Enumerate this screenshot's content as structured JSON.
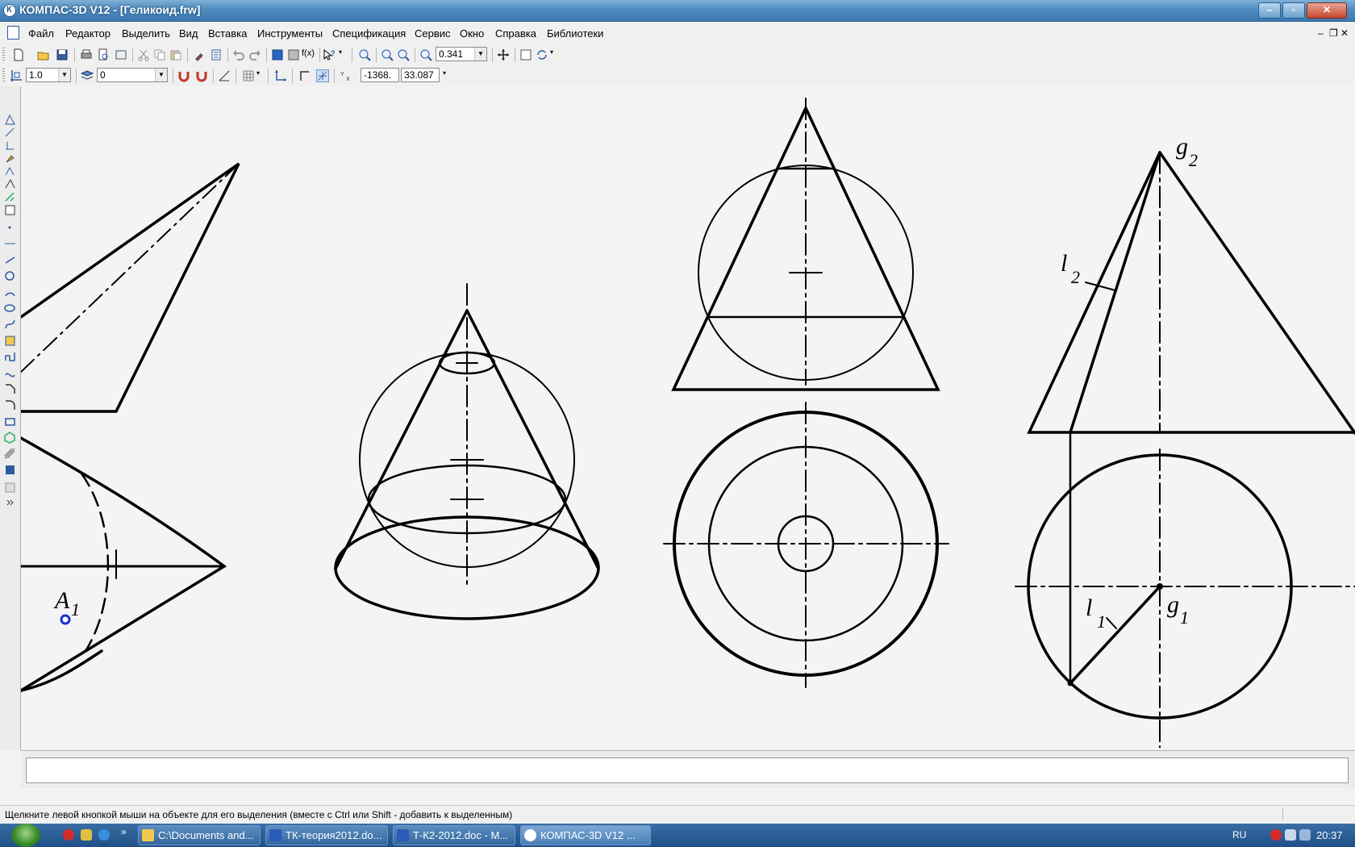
{
  "window": {
    "title": "КОМПАС-3D V12 - [Геликоид.frw]"
  },
  "menu": [
    "Файл",
    "Редактор",
    "Выделить",
    "Вид",
    "Вставка",
    "Инструменты",
    "Спецификация",
    "Сервис",
    "Окно",
    "Справка",
    "Библиотеки"
  ],
  "toolbar": {
    "zoom_value": "0.341",
    "step_value": "1.0",
    "layer_value": "0",
    "coord_x": "-1368.",
    "coord_y": "33.087",
    "fx_label": "f(x)"
  },
  "drawing": {
    "labels": {
      "a1_main": "A",
      "a1_sub": "1",
      "g2_main": "g",
      "g2_sub": "2",
      "l2_main": "l",
      "l2_sub": "2",
      "l1_main": "l",
      "l1_sub": "1",
      "g1_main": "g",
      "g1_sub": "1"
    }
  },
  "status": {
    "hint": "Щелкните левой кнопкой мыши на объекте для его выделения (вместе с Ctrl или Shift - добавить к выделенным)"
  },
  "taskbar": {
    "items": [
      "C:\\Documents and...",
      "ТК-теория2012.do...",
      "Т-К2-2012.doc - М...",
      "КОМПАС-3D V12 ..."
    ],
    "lang": "RU",
    "clock": "20:37"
  }
}
